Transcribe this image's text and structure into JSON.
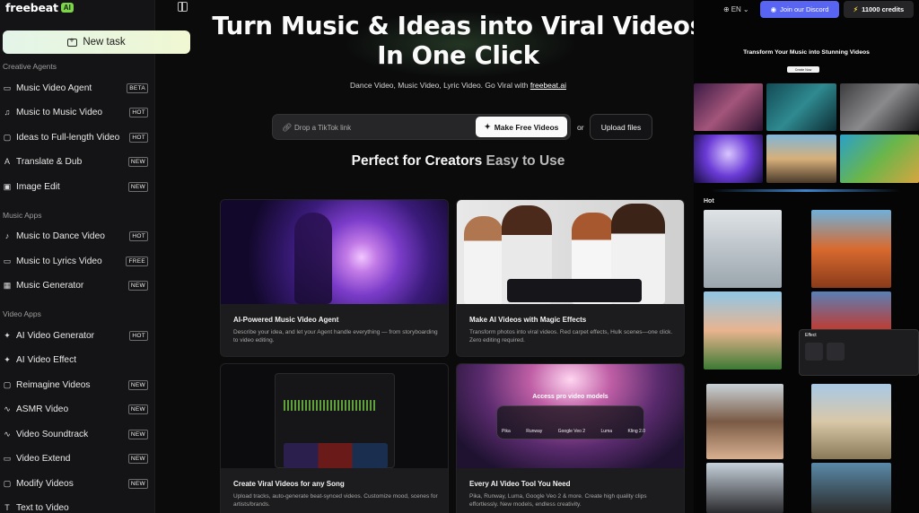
{
  "app": {
    "logo_text": "freebeat",
    "logo_badge": "AI"
  },
  "sidebar": {
    "new_task_label": "New task",
    "sections": [
      {
        "title": "Creative Agents"
      },
      {
        "title": "Music Apps"
      },
      {
        "title": "Video Apps"
      }
    ],
    "items": [
      {
        "label": "Music Video Agent",
        "badge": "BETA",
        "icon": "chat-icon"
      },
      {
        "label": "Music to Music Video",
        "badge": "HOT",
        "icon": "music-note-icon"
      },
      {
        "label": "Ideas to Full-length Video",
        "badge": "HOT",
        "icon": "lightbulb-icon"
      },
      {
        "label": "Translate & Dub",
        "badge": "NEW",
        "icon": "translate-icon"
      },
      {
        "label": "Image Edit",
        "badge": "NEW",
        "icon": "image-icon"
      },
      {
        "label": "Music to Dance Video",
        "badge": "HOT",
        "icon": "music-note-icon"
      },
      {
        "label": "Music to Lyrics Video",
        "badge": "FREE",
        "icon": "lyrics-icon"
      },
      {
        "label": "Music Generator",
        "badge": "NEW",
        "icon": "music-generator-icon"
      },
      {
        "label": "AI Video Generator",
        "badge": "HOT",
        "icon": "sparkle-icon"
      },
      {
        "label": "AI Video Effect",
        "badge": "",
        "icon": "sparkle-icon"
      },
      {
        "label": "Reimagine Videos",
        "badge": "NEW",
        "icon": "reimagine-icon"
      },
      {
        "label": "ASMR Video",
        "badge": "NEW",
        "icon": "waveform-icon"
      },
      {
        "label": "Video Soundtrack",
        "badge": "NEW",
        "icon": "waveform-icon"
      },
      {
        "label": "Video Extend",
        "badge": "NEW",
        "icon": "extend-icon"
      },
      {
        "label": "Modify Videos",
        "badge": "NEW",
        "icon": "modify-icon"
      },
      {
        "label": "Text to Video",
        "badge": "",
        "icon": "text-icon"
      }
    ]
  },
  "hero": {
    "title_line1": "Turn Music & Ideas into Viral Videos",
    "title_line2": "In One Click",
    "subtitle_prefix": "Dance Video, Music Video, Lyric Video. Go Viral with ",
    "subtitle_link": "freebeat.ai",
    "input_placeholder": "Drop a TikTok link",
    "make_button": "Make Free Videos",
    "or_text": "or",
    "upload_button": "Upload files"
  },
  "section": {
    "heading_main": "Perfect for Creators",
    "heading_accent": "Easy to Use"
  },
  "cards": [
    {
      "title": "AI-Powered Music Video Agent",
      "desc": "Describe your idea, and let your Agent handle everything — from storyboarding to video editing."
    },
    {
      "title": "Make AI Videos with Magic Effects",
      "desc": "Transform photos into viral videos. Red carpet effects, Hulk scenes—one click. Zero editing required."
    },
    {
      "title": "Create Viral Videos for any Song",
      "desc": "Upload tracks, auto-generate beat-synced videos. Customize mood, scenes for artists/brands."
    },
    {
      "title": "Every AI Video Tool You Need",
      "desc": "Pika, Runway, Luma, Google Veo 2 & more. Create high quality clips effortlessly. New models, endless creativity.",
      "overlay_title": "Access pro video models",
      "models": [
        "Pika",
        "Runway",
        "Google Veo 2",
        "Luma",
        "Kling 2.0"
      ]
    }
  ],
  "topbar": {
    "language": "EN",
    "discord_button": "Join our Discord",
    "credits_button": "11000 credits"
  },
  "right_panel": {
    "promo_title": "Transform Your Music into Stunning Videos",
    "promo_button": "Create Now",
    "hot_label": "Hot",
    "effect_panel_title": "Effect"
  },
  "colors": {
    "brand_green": "#7dd44a",
    "discord": "#5865f2",
    "background": "#0b0b0c"
  }
}
